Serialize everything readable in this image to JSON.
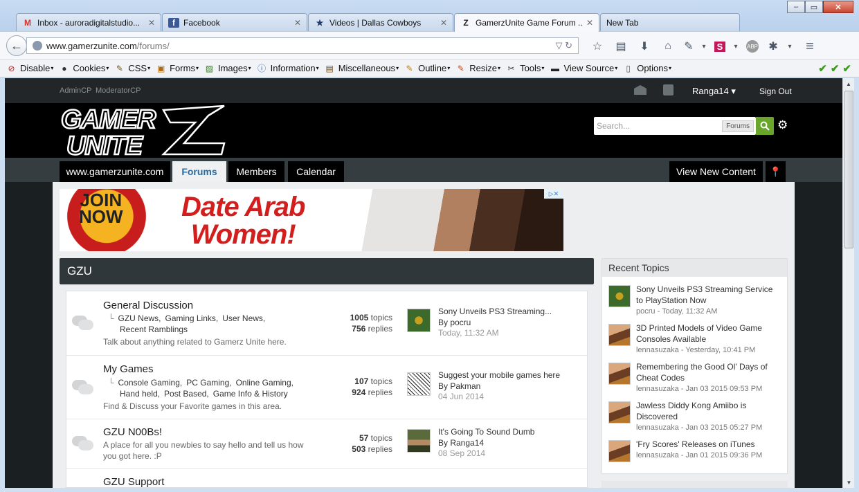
{
  "browser": {
    "window_controls": [
      "–",
      "▭",
      "✕"
    ],
    "tabs": [
      {
        "icon": "gmail-icon",
        "icon_glyph": "M",
        "icon_color": "#d93025",
        "title": "Inbox - auroradigitalstudio...",
        "close": "✕"
      },
      {
        "icon": "facebook-icon",
        "icon_glyph": "f",
        "icon_color": "#3b5998",
        "title": "Facebook",
        "close": "✕"
      },
      {
        "icon": "star-icon",
        "icon_glyph": "★",
        "icon_color": "#1f3a6b",
        "title": "Videos | Dallas Cowboys",
        "close": "✕"
      },
      {
        "icon": "gzu-favicon",
        "icon_glyph": "Z",
        "icon_color": "#222222",
        "title": "GamerzUnite Game Forum ...",
        "close": "✕",
        "active": true
      },
      {
        "icon": "",
        "icon_glyph": "",
        "icon_color": "",
        "title": "New Tab",
        "close": ""
      }
    ],
    "url_host": "www.gamerzunite.com",
    "url_path": "/forums/",
    "url_tail": "▽ ↻",
    "nav_icons": [
      {
        "name": "bookmark-star-icon",
        "glyph": "☆"
      },
      {
        "name": "reading-list-icon",
        "glyph": "▤"
      },
      {
        "name": "download-icon",
        "glyph": "⬇"
      },
      {
        "name": "home-icon",
        "glyph": "⌂"
      },
      {
        "name": "eyedropper-icon",
        "glyph": "✎"
      },
      {
        "name": "dropdown-caret-icon",
        "glyph": "▾"
      },
      {
        "name": "stylish-icon",
        "glyph": "S"
      },
      {
        "name": "dropdown-caret-icon",
        "glyph": "▾"
      },
      {
        "name": "adblock-icon",
        "glyph": "ABP"
      },
      {
        "name": "extension-icon",
        "glyph": "✱"
      },
      {
        "name": "dropdown-caret-icon",
        "glyph": "▾"
      },
      {
        "name": "menu-icon",
        "glyph": "≡"
      }
    ],
    "devbar": [
      {
        "label": "Disable",
        "icon": "no-icon",
        "glyph": "⊘",
        "color": "#c0201a"
      },
      {
        "label": "Cookies",
        "icon": "cookie-person-icon",
        "glyph": "●",
        "color": "#333333"
      },
      {
        "label": "CSS",
        "icon": "css-pencil-icon",
        "glyph": "✎",
        "color": "#7a5a10"
      },
      {
        "label": "Forms",
        "icon": "forms-icon",
        "glyph": "▣",
        "color": "#b06a10"
      },
      {
        "label": "Images",
        "icon": "images-icon",
        "glyph": "▨",
        "color": "#3a7a2a"
      },
      {
        "label": "Information",
        "icon": "info-icon",
        "glyph": "ⓘ",
        "color": "#1f5fb5"
      },
      {
        "label": "Miscellaneous",
        "icon": "misc-icon",
        "glyph": "▤",
        "color": "#6a4a20"
      },
      {
        "label": "Outline",
        "icon": "outline-pencil-icon",
        "glyph": "✎",
        "color": "#c08020"
      },
      {
        "label": "Resize",
        "icon": "resize-pencil-icon",
        "glyph": "✎",
        "color": "#c05020"
      },
      {
        "label": "Tools",
        "icon": "tools-icon",
        "glyph": "✂",
        "color": "#444444"
      },
      {
        "label": "View Source",
        "icon": "view-source-icon",
        "glyph": "▬",
        "color": "#222222"
      },
      {
        "label": "Options",
        "icon": "options-icon",
        "glyph": "▯",
        "color": "#555555"
      }
    ],
    "devbar_checks": "✔✔✔"
  },
  "site": {
    "topbar": {
      "admin_cp": "AdminCP",
      "moderator_cp": "ModeratorCP",
      "username": "Ranga14 ▾",
      "sign_out": "Sign Out"
    },
    "logo_text": "GAMERZ UNITE",
    "search": {
      "placeholder": "Search...",
      "scope": "Forums",
      "button": "🔍",
      "settings": "⚙"
    },
    "nav_tabs": [
      {
        "label": "www.gamerzunite.com"
      },
      {
        "label": "Forums",
        "active": true
      },
      {
        "label": "Members"
      },
      {
        "label": "Calendar"
      },
      {
        "label": "View New Content"
      },
      {
        "label": "📍"
      }
    ],
    "ad": {
      "badge_line1": "JOIN",
      "badge_line2": "NOW",
      "headline_line1": "Date Arab",
      "headline_line2": "Women!",
      "adchoices": "▷✕"
    },
    "section_title": "GZU",
    "forums": [
      {
        "title": "General Discussion",
        "subforums": [
          "GZU News,",
          "Gaming Links,",
          "User News,",
          "Recent Ramblings"
        ],
        "description": "Talk about anything related to Gamerz Unite here.",
        "topics": "1005",
        "topics_label": "topics",
        "replies": "756",
        "replies_label": "replies",
        "last_title": "Sony Unveils PS3 Streaming...",
        "last_by": "By pocru",
        "last_date": "Today, 11:32 AM"
      },
      {
        "title": "My Games",
        "subforums": [
          "Console Gaming,",
          "PC Gaming,",
          "Online Gaming,",
          "Hand held,",
          "Post Based,",
          "Game Info & History"
        ],
        "description": "Find & Discuss your Favorite games in this area.",
        "topics": "107",
        "topics_label": "topics",
        "replies": "924",
        "replies_label": "replies",
        "last_title": "Suggest your mobile games here",
        "last_by": "By Pakman",
        "last_date": "04 Jun 2014"
      },
      {
        "title": "GZU N00Bs!",
        "subforums": [],
        "description": "A place for all you newbies to say hello and tell us how you got here. :P",
        "topics": "57",
        "topics_label": "topics",
        "replies": "503",
        "replies_label": "replies",
        "last_title": "It's Going To Sound Dumb",
        "last_by": "By Ranga14",
        "last_date": "08 Sep 2014"
      },
      {
        "title": "GZU Support"
      }
    ],
    "recent": {
      "title": "Recent Topics",
      "items": [
        {
          "title": "Sony Unveils PS3 Streaming Service to PlayStation Now",
          "meta": "pocru - Today, 11:32 AM"
        },
        {
          "title": "3D Printed Models of Video Game Consoles Available",
          "meta": "lennasuzaka - Yesterday, 10:41 PM"
        },
        {
          "title": "Remembering the Good Ol' Days of Cheat Codes",
          "meta": "lennasuzaka - Jan 03 2015 09:53 PM"
        },
        {
          "title": "Jawless Diddy Kong Amiibo is Discovered",
          "meta": "lennasuzaka - Jan 03 2015 05:27 PM"
        },
        {
          "title": "'Fry Scores' Releases on iTunes",
          "meta": "lennasuzaka - Jan 01 2015 09:36 PM"
        }
      ]
    }
  }
}
